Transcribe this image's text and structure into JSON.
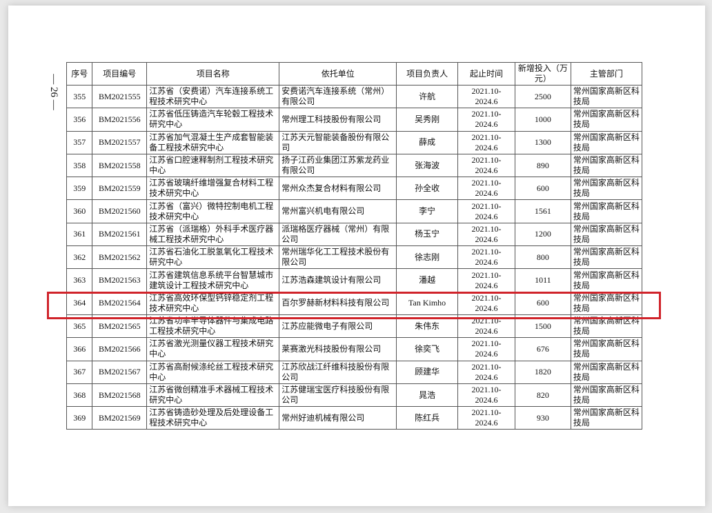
{
  "page_number": "— 26 —",
  "table": {
    "headers": [
      "序号",
      "项目编号",
      "项目名称",
      "依托单位",
      "项目负责人",
      "起止时间",
      "新增投入（万元）",
      "主管部门"
    ],
    "rows": [
      [
        "355",
        "BM2021555",
        "江苏省（安费诺）汽车连接系统工程技术研究中心",
        "安费诺汽车连接系统（常州）有限公司",
        "许航",
        "2021.10-2024.6",
        "2500",
        "常州国家高新区科技局"
      ],
      [
        "356",
        "BM2021556",
        "江苏省低压铸造汽车轮毂工程技术研究中心",
        "常州理工科技股份有限公司",
        "吴秀刚",
        "2021.10-2024.6",
        "1000",
        "常州国家高新区科技局"
      ],
      [
        "357",
        "BM2021557",
        "江苏省加气混凝土生产成套智能装备工程技术研究中心",
        "江苏天元智能装备股份有限公司",
        "薛成",
        "2021.10-2024.6",
        "1300",
        "常州国家高新区科技局"
      ],
      [
        "358",
        "BM2021558",
        "江苏省口腔速释制剂工程技术研究中心",
        "扬子江药业集团江苏紫龙药业有限公司",
        "张海波",
        "2021.10-2024.6",
        "890",
        "常州国家高新区科技局"
      ],
      [
        "359",
        "BM2021559",
        "江苏省玻璃纤维增强复合材料工程技术研究中心",
        "常州众杰复合材料有限公司",
        "孙全收",
        "2021.10-2024.6",
        "600",
        "常州国家高新区科技局"
      ],
      [
        "360",
        "BM2021560",
        "江苏省（富兴）微特控制电机工程技术研究中心",
        "常州富兴机电有限公司",
        "李宁",
        "2021.10-2024.6",
        "1561",
        "常州国家高新区科技局"
      ],
      [
        "361",
        "BM2021561",
        "江苏省（派瑞格）外科手术医疗器械工程技术研究中心",
        "派瑞格医疗器械（常州）有限公司",
        "杨玉宁",
        "2021.10-2024.6",
        "1200",
        "常州国家高新区科技局"
      ],
      [
        "362",
        "BM2021562",
        "江苏省石油化工脱氢氧化工程技术研究中心",
        "常州瑞华化工工程技术股份有限公司",
        "徐志刚",
        "2021.10-2024.6",
        "800",
        "常州国家高新区科技局"
      ],
      [
        "363",
        "BM2021563",
        "江苏省建筑信息系统平台智慧城市建筑设计工程技术研究中心",
        "江苏浩森建筑设计有限公司",
        "潘越",
        "2021.10-2024.6",
        "1011",
        "常州国家高新区科技局"
      ],
      [
        "364",
        "BM2021564",
        "江苏省高效环保型钙锌稳定剂工程技术研究中心",
        "百尔罗赫新材料科技有限公司",
        "Tan Kimho",
        "2021.10-2024.6",
        "600",
        "常州国家高新区科技局"
      ],
      [
        "365",
        "BM2021565",
        "江苏省功率半导体器件与集成电路工程技术研究中心",
        "江苏应能微电子有限公司",
        "朱伟东",
        "2021.10-2024.6",
        "1500",
        "常州国家高新区科技局"
      ],
      [
        "366",
        "BM2021566",
        "江苏省激光测量仪器工程技术研究中心",
        "莱赛激光科技股份有限公司",
        "徐奕飞",
        "2021.10-2024.6",
        "676",
        "常州国家高新区科技局"
      ],
      [
        "367",
        "BM2021567",
        "江苏省高耐候涤纶丝工程技术研究中心",
        "江苏欣战江纤维科技股份有限公司",
        "顾建华",
        "2021.10-2024.6",
        "1820",
        "常州国家高新区科技局"
      ],
      [
        "368",
        "BM2021568",
        "江苏省微创精准手术器械工程技术研究中心",
        "江苏健瑞宝医疗科技股份有限公司",
        "晁浩",
        "2021.10-2024.6",
        "820",
        "常州国家高新区科技局"
      ],
      [
        "369",
        "BM2021569",
        "江苏省铸造砂处理及后处理设备工程技术研究中心",
        "常州好迪机械有限公司",
        "陈红兵",
        "2021.10-2024.6",
        "930",
        "常州国家高新区科技局"
      ]
    ]
  },
  "highlight_row_index": 9,
  "colors": {
    "highlight": "#d0232a",
    "border": "#555555"
  }
}
